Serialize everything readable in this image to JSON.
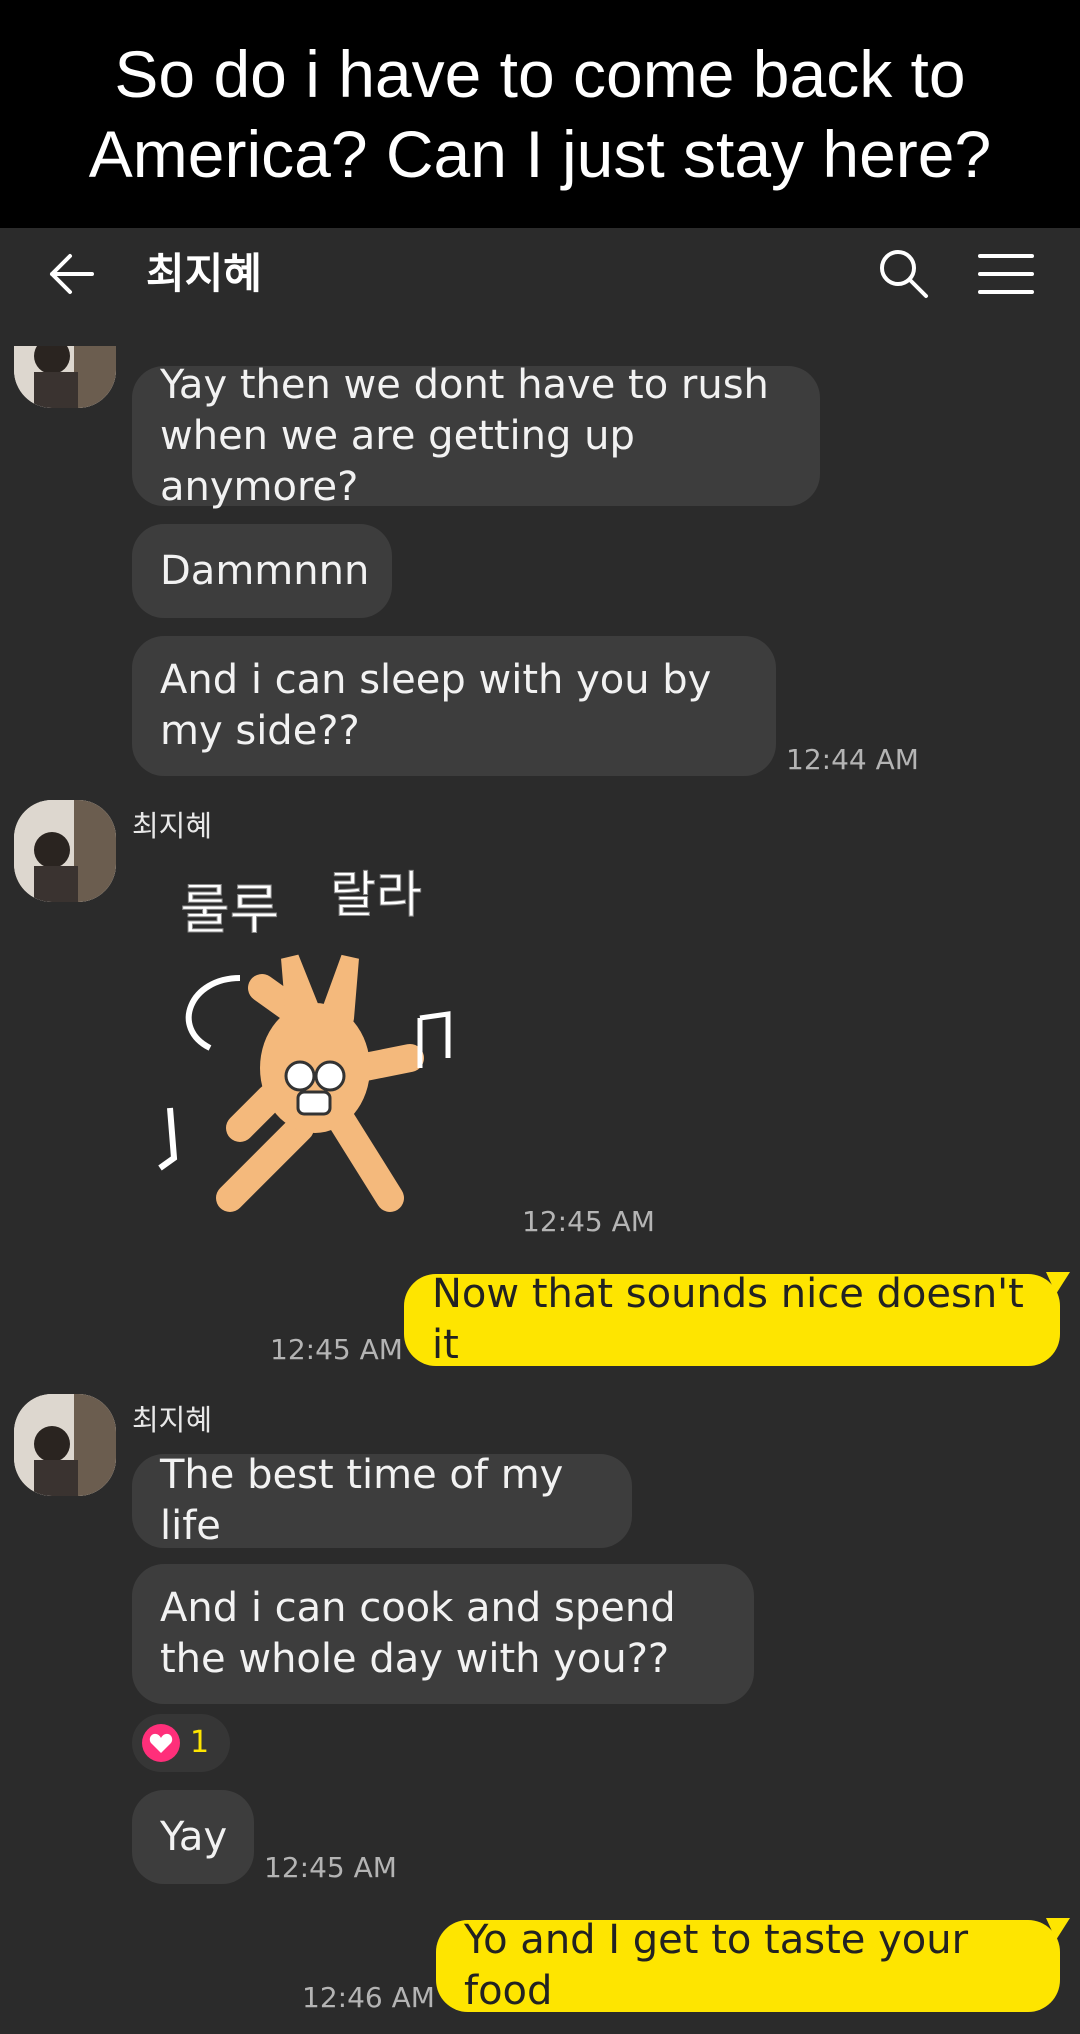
{
  "caption": "So do i have to come back to America? Can I just stay here?",
  "header": {
    "title": "최지혜"
  },
  "messages": {
    "m1": "Yay then we dont have to rush when we are getting up anymore?",
    "m2": "Dammnnn",
    "m3": "And i can sleep with you by my side??",
    "t1": "12:44 AM",
    "sender2": "최지혜",
    "t2": "12:45 AM",
    "m4": "Now that sounds nice doesn't it",
    "t3": "12:45 AM",
    "sender3": "최지혜",
    "m5": "The best time of my life",
    "m6": "And i can cook and spend the whole day with you??",
    "reaction_count": "1",
    "m7": "Yay",
    "t4": "12:45 AM",
    "m8": "Yo and I get to taste your food",
    "t5": "12:46 AM"
  },
  "sticker": {
    "text_left": "룰루",
    "text_right": "랄라"
  },
  "colors": {
    "my_bubble": "#fee500",
    "their_bubble": "#3d3d3d",
    "background": "#2b2b2b",
    "heart": "#ff2f7a"
  },
  "icons": [
    "back-arrow-icon",
    "search-icon",
    "menu-icon",
    "heart-icon"
  ]
}
